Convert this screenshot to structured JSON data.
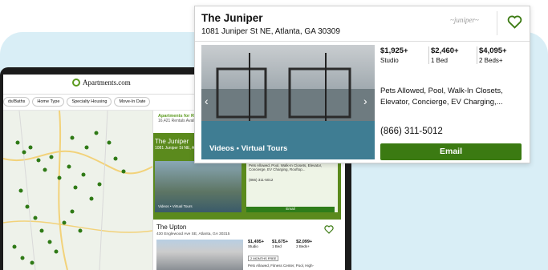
{
  "background": {
    "blob_color": "#d9eef6",
    "accent": "#3b7a12"
  },
  "site": {
    "logo_text": "Apartments.com"
  },
  "filters": [
    "ds/Baths",
    "Home Type",
    "Specialty Housing",
    "Move-In Date"
  ],
  "results_header": {
    "title": "Apartments for R...",
    "count": "16,421 Rentals Availa..."
  },
  "mini_listing": {
    "title": "The Juniper",
    "address": "1081 Juniper St NE, A...",
    "amenities": "Pets Allowed, Pool, Walk-In Closets, Elevator, Concierge, EV Charging, Rooftop...",
    "phone": "(866) 311-5012",
    "email_label": "Email",
    "caption": "Videos • Virtual Tours"
  },
  "listing2": {
    "title": "The Upton",
    "address": "430 Englewood Ave SE, Atlanta, GA 30315",
    "prices": [
      {
        "value": "$1,495+",
        "label": "Studio"
      },
      {
        "value": "$1,675+",
        "label": "1 Bed"
      },
      {
        "value": "$2,099+",
        "label": "2 Beds+"
      }
    ],
    "badge": "2 MONTHS FREE",
    "amenities": "Pets Allowed, Fitness Center, Pool, High-"
  },
  "popup": {
    "title": "The Juniper",
    "address": "1081 Juniper St NE, Atlanta, GA 30309",
    "prices": [
      {
        "value": "$1,925+",
        "label": "Studio"
      },
      {
        "value": "$2,460+",
        "label": "1 Bed"
      },
      {
        "value": "$4,095+",
        "label": "2 Beds+"
      }
    ],
    "amenities": "Pets Allowed, Pool, Walk-In Closets, Elevator, Concierge, EV Charging,...",
    "phone": "(866) 311-5012",
    "email_label": "Email",
    "photo_caption": "Videos • Virtual Tours"
  }
}
